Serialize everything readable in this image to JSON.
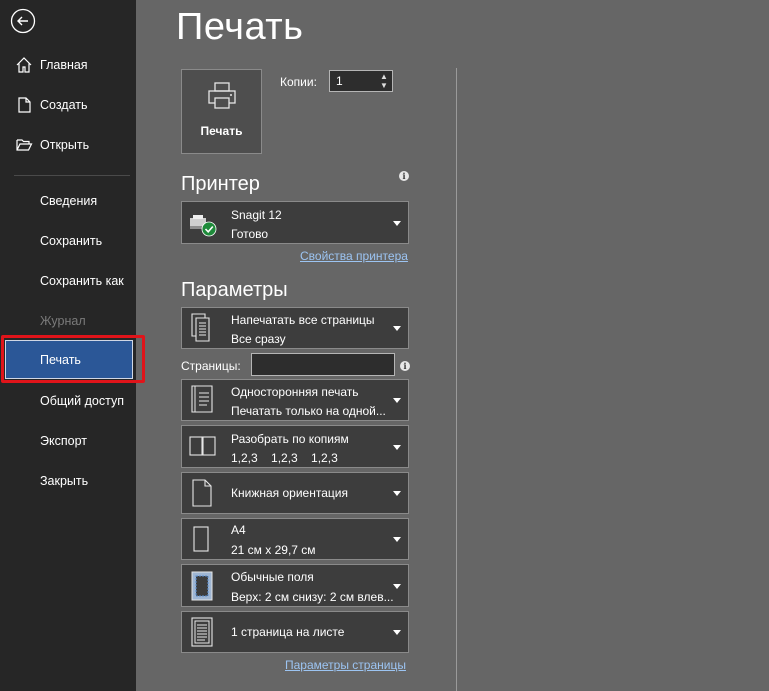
{
  "sidebar": {
    "back_icon": "arrow-left-circle-icon",
    "items": [
      {
        "label": "Главная",
        "icon": "home-icon"
      },
      {
        "label": "Создать",
        "icon": "new-document-icon"
      },
      {
        "label": "Открыть",
        "icon": "open-folder-icon"
      },
      {
        "label": "Сведения"
      },
      {
        "label": "Сохранить"
      },
      {
        "label": "Сохранить как"
      },
      {
        "label": "Журнал",
        "disabled": true
      },
      {
        "label": "Печать",
        "active": true
      },
      {
        "label": "Общий доступ"
      },
      {
        "label": "Экспорт"
      },
      {
        "label": "Закрыть"
      }
    ]
  },
  "main": {
    "title": "Печать",
    "print_button": {
      "label": "Печать",
      "icon": "printer-icon"
    },
    "copies": {
      "label": "Копии:",
      "value": "1"
    },
    "printer": {
      "section_title": "Принтер",
      "name": "Snagit 12",
      "status": "Готово",
      "icon": "printer-ready-icon",
      "properties_link": "Свойства принтера"
    },
    "settings": {
      "section_title": "Параметры",
      "pages_label": "Страницы:",
      "pages_value": "",
      "setup_link": "Параметры страницы",
      "dropdowns": [
        {
          "line1": "Напечатать все страницы",
          "line2": "Все сразу",
          "icon": "all-pages-icon"
        },
        {
          "line1": "Односторонняя печать",
          "line2": "Печатать только на одной...",
          "icon": "one-sided-icon"
        },
        {
          "line1": "Разобрать по копиям",
          "line2": "1,2,3    1,2,3    1,2,3",
          "icon": "collate-icon"
        },
        {
          "line1": "Книжная ориентация",
          "line2": "",
          "icon": "portrait-icon"
        },
        {
          "line1": "A4",
          "line2": "21 см x 29,7 см",
          "icon": "paper-size-icon"
        },
        {
          "line1": "Обычные поля",
          "line2": "Верх: 2 см снизу: 2 см влев...",
          "icon": "margins-icon"
        },
        {
          "line1": "1 страница на листе",
          "line2": "",
          "icon": "pages-per-sheet-icon"
        }
      ]
    }
  },
  "colors": {
    "sidebar_bg": "#262626",
    "main_bg": "#666666",
    "active_item": "#2b5797",
    "highlight": "#e0141a",
    "link": "#9cc4f2"
  }
}
